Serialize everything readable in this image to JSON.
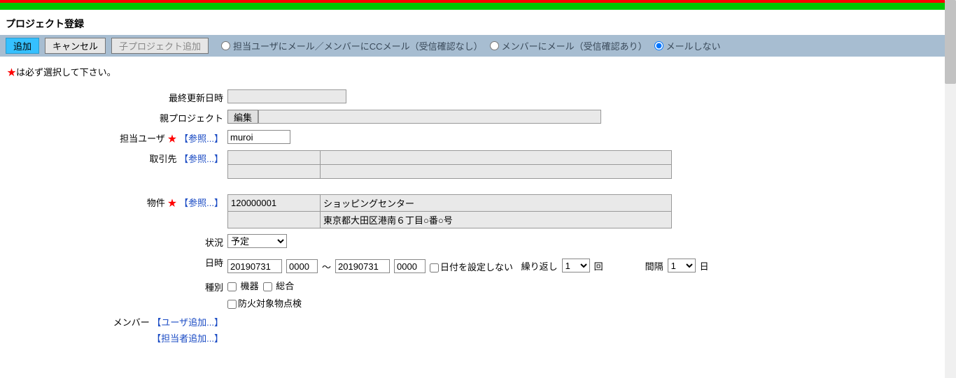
{
  "header": {
    "title": "プロジェクト登録"
  },
  "toolbar": {
    "add": "追加",
    "cancel": "キャンセル",
    "addChild": "子プロジェクト追加",
    "mailOptions": [
      "担当ユーザにメール／メンバーにCCメール（受信確認なし）",
      "メンバーにメール（受信確認あり）",
      "メールしない"
    ],
    "mailSelected": 2
  },
  "note": {
    "star": "★",
    "text": "は必ず選択して下さい。"
  },
  "labels": {
    "lastUpdate": "最終更新日時",
    "parentProject": "親プロジェクト",
    "editBtn": "編集",
    "assignedUser": "担当ユーザ",
    "refLink": "【参照...】",
    "client": "取引先",
    "property": "物件",
    "status": "状況",
    "datetime": "日時",
    "dateNotSet": "日付を設定しない",
    "repeat": "繰り返し",
    "repeatUnit": "回",
    "interval": "間隔",
    "intervalUnit": "日",
    "type": "種別",
    "member": "メンバー",
    "userAdd": "【ユーザ追加...】",
    "tantoAdd": "【担当者追加...】",
    "tilde": "～"
  },
  "values": {
    "assignedUser": "muroi",
    "client": {
      "code": "",
      "name": "",
      "addr": ""
    },
    "property": {
      "code": "120000001",
      "name": "ショッピングセンター",
      "addr": "東京都大田区港南６丁目○番○号"
    },
    "statusOptions": [
      "予定"
    ],
    "statusSelected": "予定",
    "dateFrom": "20190731",
    "timeFrom": "0000",
    "dateTo": "20190731",
    "timeTo": "0000",
    "dateNotSetChecked": false,
    "repeatOptions": [
      "1"
    ],
    "intervalOptions": [
      "1"
    ],
    "types": [
      {
        "label": "機器",
        "checked": false
      },
      {
        "label": "総合",
        "checked": false
      },
      {
        "label": "防火対象物点検",
        "checked": false
      }
    ]
  }
}
